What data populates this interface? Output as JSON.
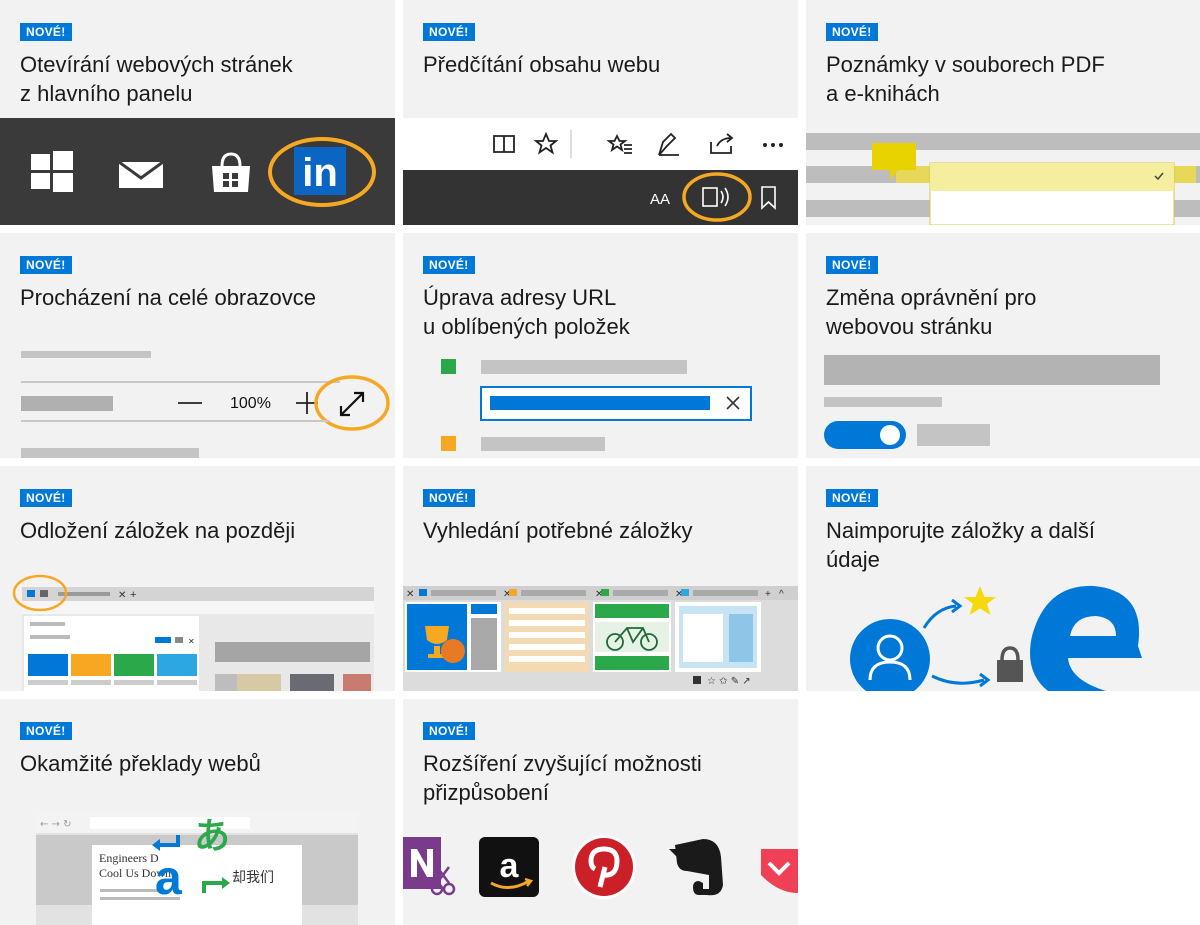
{
  "badge": "NOVÉ!",
  "tiles": [
    {
      "id": "linkedin",
      "title": "Otevírání webových stránek\nz hlavního panelu"
    },
    {
      "id": "read-aloud",
      "title": "Předčítání obsahu webu"
    },
    {
      "id": "pdf-notes",
      "title": "Poznámky v souborech PDF\na e-knihách"
    },
    {
      "id": "fullscreen",
      "title": "Procházení na celé obrazovce",
      "zoom": "100%"
    },
    {
      "id": "edit-url",
      "title": "Úprava adresy URL\nu oblíbených položek"
    },
    {
      "id": "permissions",
      "title": "Změna oprávnění pro\nwebovou stránku"
    },
    {
      "id": "tabs-aside",
      "title": "Odložení záložek na později"
    },
    {
      "id": "tab-preview",
      "title": "Vyhledání potřebné záložky"
    },
    {
      "id": "import",
      "title": "Naimporujte záložky a další\núdaje"
    },
    {
      "id": "translate",
      "title": "Okamžité překlady webů",
      "article_title": "Engineers D\nCool Us Down",
      "chinese_text": "却我们",
      "glyph_ja": "あ",
      "glyph_latin": "a"
    },
    {
      "id": "extensions",
      "title": "Rozšíření zvyšující možnosti\npřizpůsobení"
    }
  ],
  "colors": {
    "accent": "#0078d7",
    "highlight_orange": "#f7a823",
    "tile_bg": "#f2f2f2",
    "dark_bar": "#333333"
  }
}
